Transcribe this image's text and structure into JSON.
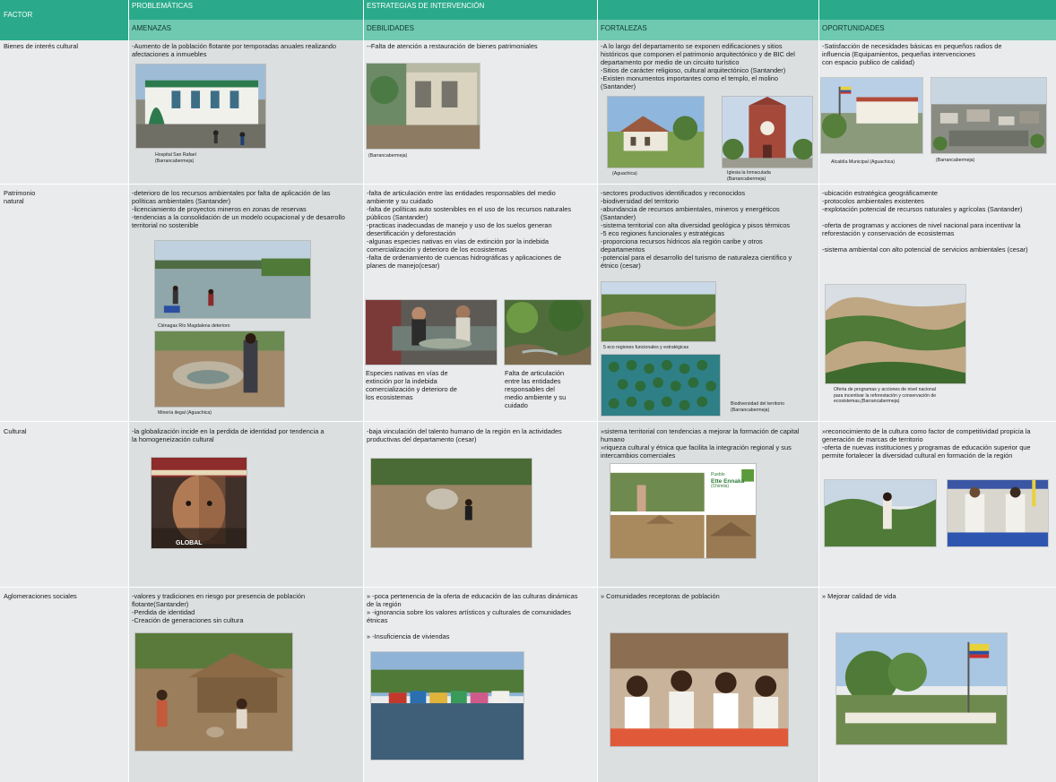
{
  "header": {
    "factor": "FACTOR",
    "problematicas": "PROBLEMÁTICAS",
    "estrategias": "ESTRATEGIAS DE INTERVENCIÓN",
    "amenazas": "AMENAZAS",
    "debilidades": "DEBILIDADES",
    "fortalezas": "FORTALEZAS",
    "oportunidades": "OPORTUNIDADES"
  },
  "rows": [
    {
      "factor": [
        "Bienes de interés cultural"
      ],
      "amenazas": [
        "-Aumento de la población flotante por  temporadas  anuales realizando",
        "afectaciones a inmuebles"
      ],
      "debilidades": [
        "--Falta de atención a restauración de bienes patrimoniales"
      ],
      "fortalezas": [
        "-A lo largo del departamento se exponen edificaciones y sitios",
        "históricos que componen el patrimonio arquitectónico y de BIC del",
        "departamento por medio de un circuito turístico",
        "-Sitios de carácter religioso, cultural arquitectónico (Santander)",
        "-Existen monumentos importantes como el templo, el molino",
        "(Santander)"
      ],
      "oportunidades": [
        "-Satisfacción de  necesidades básicas  en pequeños radios  de",
        "  influencia  (Equipamientos,  pequeñas  intervenciones",
        "  con espacio publico de calidad)"
      ],
      "captions": {
        "amenazas": [
          "Hospital San Rafael",
          "(Barrancabermeja)"
        ],
        "debilidades": [
          "(Barrancabermeja)"
        ],
        "fortalezas_a": [
          "(Aguachica)"
        ],
        "fortalezas_b": [
          "Iglesia la Inmaculada",
          "(Barrancabermeja)"
        ],
        "oportunidades_a": [
          "Alcaldía Municipal (Aguachica)"
        ],
        "oportunidades_b": [
          "(Barrancabermeja)"
        ]
      }
    },
    {
      "factor": [
        "Patrimonio",
        "natural"
      ],
      "amenazas": [
        "-deterioro de los recursos ambientales por falta de aplicación de las",
        "políticas ambientales (Santander)",
        "-licenciamiento de proyectos mineros en zonas de reservas",
        "-tendencias a la consolidación de un modelo ocupacional y de desarrollo",
        "territorial no sostenible"
      ],
      "debilidades": [
        "-falta de articulación entre las entidades responsables del medio",
        "ambiente y  su cuidado",
        "-falta de políticas auto sostenibles en el uso de los recursos naturales",
        "públicos (Santander)",
        "-practicas inadecuadas de manejo y uso de los suelos generan",
        "desertificación y deforestación",
        "-algunas especies nativas en vías de extinción por la indebida",
        "comercialización y deterioro  de los ecosistemas",
        "-falta de ordenamiento de cuencas hidrográficas y aplicaciones de",
        "planes de manejo(cesar)"
      ],
      "fortalezas": [
        "-sectores productivos  identificados y reconocidos",
        "-biodiversidad del territorio",
        "-abundancia de recursos ambientales, mineros y energéticos",
        "(Santander)",
        "-sistema territorial  con alta diversidad geológica y pisos térmicos",
        "-5 eco regiones funcionales y estratégicas",
        "-proporciona recursos hídricos ala región caribe y otros",
        "departamentos",
        "-potencial para el desarrollo del turismo de naturaleza científico y",
        "étnico (cesar)"
      ],
      "oportunidades": [
        "-ubicación estratégica geográficamente",
        "-protocolos ambientales existentes",
        "-explotación potencial de recursos naturales y agrícolas (Santander)",
        "",
        "-oferta de programas y acciones de nivel nacional para incentivar  la",
        "reforestación y conservación de ecosistemas",
        "",
        "-sistema ambiental con alto potencial de servicios ambientales (cesar)"
      ],
      "captions": {
        "amenazas_a": [
          "Ciénagas Río Magdalena deterioro"
        ],
        "amenazas_b": [
          "Minería ilegal (Aguachica)"
        ],
        "debilidades_a": [
          "Especies nativas en vías de",
          "extinción por la indebida",
          "comercialización y deterioro  de",
          "los ecosistemas"
        ],
        "debilidades_b": [
          "Falta de articulación",
          "entre las entidades",
          "responsables del",
          "medio ambiente y  su",
          "cuidado"
        ],
        "fortalezas_a": [
          "5 eco regiones funcionales y estratégicas"
        ],
        "fortalezas_b": [
          "Biodiversidad del territorio",
          "(Barrancabermeja)"
        ],
        "oportunidades": [
          "Oferta de programas y acciones de nivel nacional",
          "para incentivar  la reforestación y conservación de",
          "ecosistemas,(Barrancabermeja)"
        ]
      }
    },
    {
      "factor": [
        "Cultural"
      ],
      "amenazas": [
        "-la globalización incide en la perdida de identidad por  tendencia a",
        "la homogeneización cultural"
      ],
      "debilidades": [
        "-baja vinculación del talento humano de la región en la actividades",
        "productivas del departamento (cesar)"
      ],
      "fortalezas": [
        "»sistema territorial con tendencias a mejorar la formación de capital",
        "humano",
        "»riqueza cultural y étnica que facilita la integración regional y sus",
        "intercambios comerciales"
      ],
      "oportunidades": [
        "»reconocimiento de la cultura como factor de competitividad propicia la",
        "generación de marcas de territorio",
        "-oferta de nuevas instituciones y programas de educación superior  que",
        "permite fortalecer la diversidad cultural en formación de la región"
      ],
      "captions": {
        "amenazas": [
          "GLOBAL"
        ],
        "fortalezas_sign": [
          "Pueblo",
          "Ette Ennaka",
          "(Chimila)"
        ]
      }
    },
    {
      "factor": [
        "Aglomeraciones sociales"
      ],
      "amenazas": [
        "-valores y tradiciones en riesgo por presencia de población",
        "flotante(Santander)",
        "-Perdida de identidad",
        "-Creación de generaciones sin cultura"
      ],
      "debilidades": [
        "» -poca pertenencia de la oferta de educación de las culturas dinámicas",
        "   de la región",
        "» -ignorancia sobre los valores artísticos y culturales de comunidades",
        "   étnicas",
        "",
        "» -Insuficiencia de viviendas"
      ],
      "fortalezas": [
        "» Comunidades receptoras de población"
      ],
      "oportunidades": [
        "» Mejorar calidad de vida"
      ]
    }
  ],
  "colors": {
    "header_dark": "#2aaa8a",
    "header_light": "#6fc8b0",
    "cell_a": "#dcdfe0",
    "cell_b": "#e9ebec"
  }
}
